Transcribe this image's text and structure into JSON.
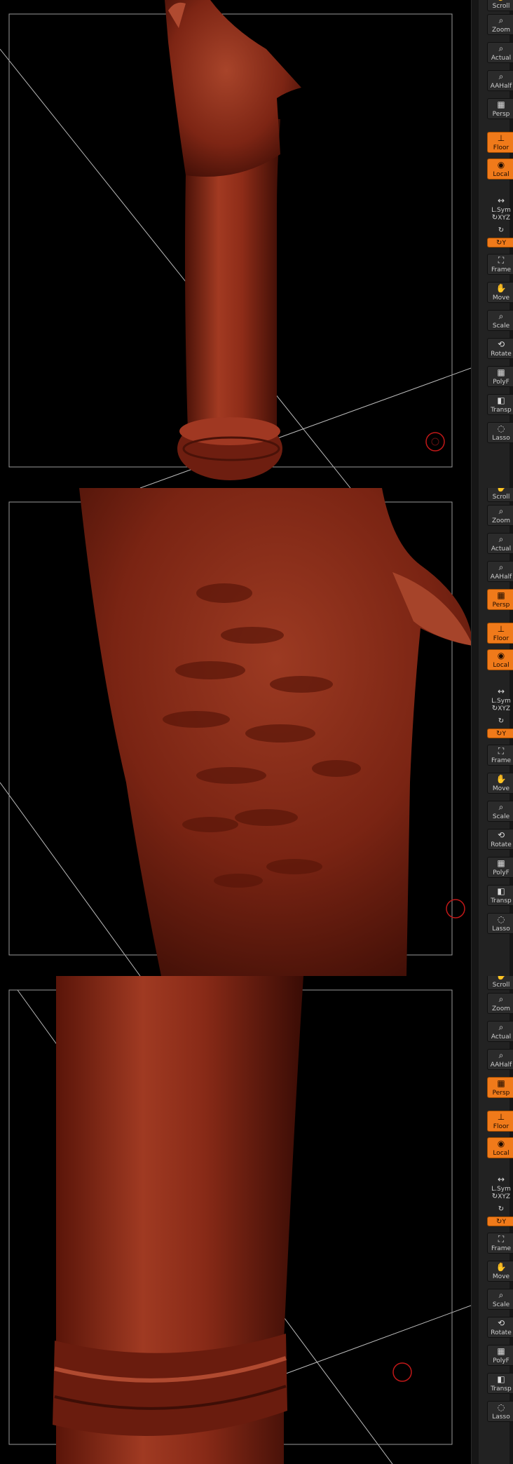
{
  "colors": {
    "accent": "#f07a1a",
    "model": "#8e2a18",
    "background": "#000000",
    "toolbar": "#222222"
  },
  "panels": [
    {
      "toolbar": [
        {
          "label": "Scroll",
          "icon": "scroll-icon",
          "active": false
        },
        {
          "label": "Zoom",
          "icon": "zoom-icon",
          "active": false
        },
        {
          "label": "Actual",
          "icon": "actual-icon",
          "active": false
        },
        {
          "label": "AAHalf",
          "icon": "aahalf-icon",
          "active": false
        },
        {
          "label": "Persp",
          "icon": "persp-icon",
          "active": false
        },
        {
          "label": "Floor",
          "icon": "floor-icon",
          "active": true
        },
        {
          "label": "Local",
          "icon": "local-icon",
          "active": true
        },
        {
          "label": "L.Sym",
          "icon": "lsym-icon",
          "active": false
        },
        {
          "label": "XYZ",
          "icon": "rotate-xyz-icon",
          "active": false
        },
        {
          "label": "",
          "icon": "rotate-z-icon",
          "active": false
        },
        {
          "label": "Y",
          "icon": "rotate-y-icon",
          "active": true
        },
        {
          "label": "Frame",
          "icon": "frame-icon",
          "active": false
        },
        {
          "label": "Move",
          "icon": "move-icon",
          "active": false
        },
        {
          "label": "Scale",
          "icon": "scale-icon",
          "active": false
        },
        {
          "label": "Rotate",
          "icon": "rotate-icon",
          "active": false
        },
        {
          "label": "PolyF",
          "icon": "polyf-icon",
          "active": false
        },
        {
          "label": "Transp",
          "icon": "transp-icon",
          "active": false
        },
        {
          "label": "Lasso",
          "icon": "lasso-icon",
          "active": false
        }
      ]
    },
    {
      "toolbar": [
        {
          "label": "Scroll",
          "icon": "scroll-icon",
          "active": false
        },
        {
          "label": "Zoom",
          "icon": "zoom-icon",
          "active": false
        },
        {
          "label": "Actual",
          "icon": "actual-icon",
          "active": false
        },
        {
          "label": "AAHalf",
          "icon": "aahalf-icon",
          "active": false
        },
        {
          "label": "Persp",
          "icon": "persp-icon",
          "active": true
        },
        {
          "label": "Floor",
          "icon": "floor-icon",
          "active": true
        },
        {
          "label": "Local",
          "icon": "local-icon",
          "active": true
        },
        {
          "label": "L.Sym",
          "icon": "lsym-icon",
          "active": false
        },
        {
          "label": "XYZ",
          "icon": "rotate-xyz-icon",
          "active": false
        },
        {
          "label": "",
          "icon": "rotate-z-icon",
          "active": false
        },
        {
          "label": "Y",
          "icon": "rotate-y-icon",
          "active": true
        },
        {
          "label": "Frame",
          "icon": "frame-icon",
          "active": false
        },
        {
          "label": "Move",
          "icon": "move-icon",
          "active": false
        },
        {
          "label": "Scale",
          "icon": "scale-icon",
          "active": false
        },
        {
          "label": "Rotate",
          "icon": "rotate-icon",
          "active": false
        },
        {
          "label": "PolyF",
          "icon": "polyf-icon",
          "active": false
        },
        {
          "label": "Transp",
          "icon": "transp-icon",
          "active": false
        },
        {
          "label": "Lasso",
          "icon": "lasso-icon",
          "active": false
        }
      ]
    },
    {
      "toolbar": [
        {
          "label": "Scroll",
          "icon": "scroll-icon",
          "active": false
        },
        {
          "label": "Zoom",
          "icon": "zoom-icon",
          "active": false
        },
        {
          "label": "Actual",
          "icon": "actual-icon",
          "active": false
        },
        {
          "label": "AAHalf",
          "icon": "aahalf-icon",
          "active": false
        },
        {
          "label": "Persp",
          "icon": "persp-icon",
          "active": true
        },
        {
          "label": "Floor",
          "icon": "floor-icon",
          "active": true
        },
        {
          "label": "Local",
          "icon": "local-icon",
          "active": true
        },
        {
          "label": "L.Sym",
          "icon": "lsym-icon",
          "active": false
        },
        {
          "label": "XYZ",
          "icon": "rotate-xyz-icon",
          "active": false
        },
        {
          "label": "",
          "icon": "rotate-z-icon",
          "active": false
        },
        {
          "label": "Y",
          "icon": "rotate-y-icon",
          "active": true
        },
        {
          "label": "Frame",
          "icon": "frame-icon",
          "active": false
        },
        {
          "label": "Move",
          "icon": "move-icon",
          "active": false
        },
        {
          "label": "Scale",
          "icon": "scale-icon",
          "active": false
        },
        {
          "label": "Rotate",
          "icon": "rotate-icon",
          "active": false
        },
        {
          "label": "PolyF",
          "icon": "polyf-icon",
          "active": false
        },
        {
          "label": "Transp",
          "icon": "transp-icon",
          "active": false
        },
        {
          "label": "Lasso",
          "icon": "lasso-icon",
          "active": false
        }
      ]
    }
  ]
}
